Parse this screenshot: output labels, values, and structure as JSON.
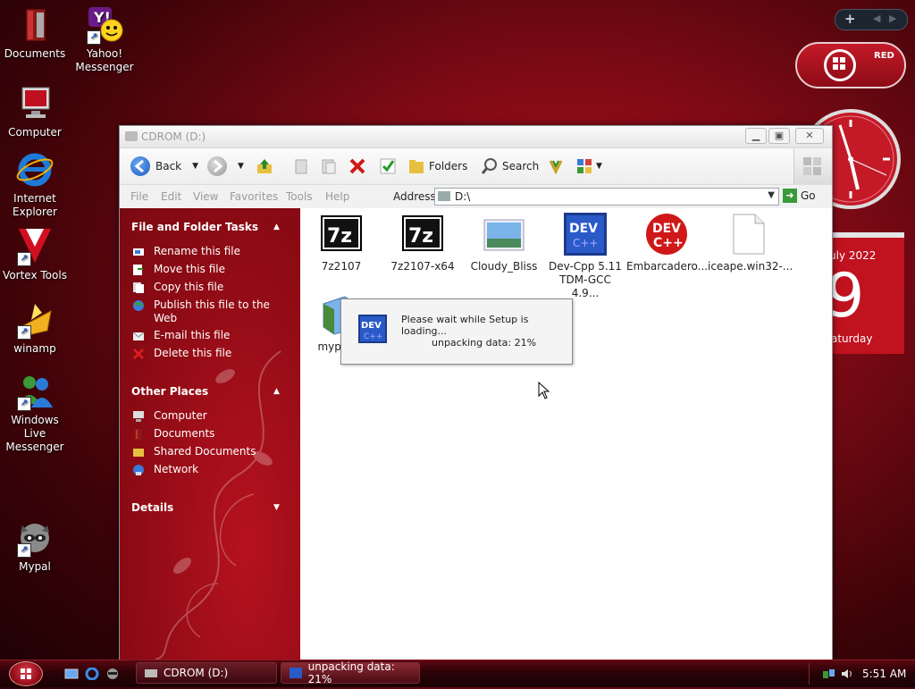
{
  "desktop": {
    "icons": [
      {
        "label": "Documents"
      },
      {
        "label": "Yahoo! Messenger"
      },
      {
        "label": "Computer"
      },
      {
        "label": "Internet Explorer"
      },
      {
        "label": "Vortex Tools"
      },
      {
        "label": "winamp"
      },
      {
        "label": "Windows Live Messenger"
      },
      {
        "label": "Mypal"
      }
    ],
    "calendar": {
      "month": "uly 2022",
      "day": "9",
      "weekday": "aturday"
    },
    "brand": {
      "label": "RED"
    }
  },
  "window": {
    "title": "CDROM (D:)",
    "toolbar": {
      "back": "Back",
      "folders": "Folders",
      "search": "Search"
    },
    "menus": [
      "File",
      "Edit",
      "View",
      "Favorites",
      "Tools",
      "Help"
    ],
    "address": {
      "label": "Address",
      "value": "D:\\",
      "go": "Go"
    },
    "task_pane": {
      "file_tasks_title": "File and Folder Tasks",
      "file_tasks": [
        "Rename this file",
        "Move this file",
        "Copy this file",
        "Publish this file to the Web",
        "E-mail this file",
        "Delete this file"
      ],
      "other_places_title": "Other Places",
      "other_places": [
        "Computer",
        "Documents",
        "Shared Documents",
        "Network"
      ],
      "details_title": "Details"
    },
    "files": [
      {
        "name": "7z2107"
      },
      {
        "name": "7z2107-x64"
      },
      {
        "name": "Cloudy_Bliss"
      },
      {
        "name": "Dev-Cpp 5.11 TDM-GCC 4.9..."
      },
      {
        "name": "Embarcadero..."
      },
      {
        "name": "iceape.win32-..."
      },
      {
        "name": "mypal-2"
      }
    ]
  },
  "setup_dialog": {
    "message": "Please wait while Setup is loading...",
    "progress": "unpacking data: 21%",
    "percent": 21
  },
  "taskbar": {
    "buttons": [
      "CDROM (D:)",
      "unpacking data: 21%"
    ],
    "time": "5:51 AM"
  },
  "colors": {
    "accent": "#b3121f",
    "window_chrome": "#eeeeee"
  }
}
